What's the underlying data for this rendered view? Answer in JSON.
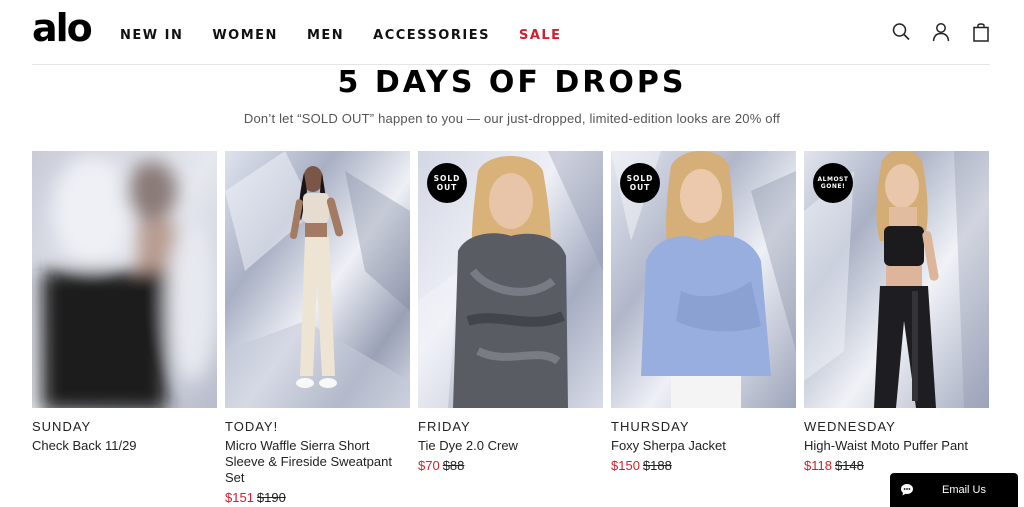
{
  "header": {
    "logo": "alo",
    "nav": [
      "NEW IN",
      "WOMEN",
      "MEN",
      "ACCESSORIES",
      "SALE"
    ],
    "icons": [
      "search-icon",
      "account-icon",
      "bag-icon"
    ]
  },
  "main": {
    "title": "5 DAYS OF DROPS",
    "subtitle": "Don’t let “SOLD OUT” happen to you — our just-dropped, limited-edition looks are 20% off"
  },
  "products": [
    {
      "day": "SUNDAY",
      "name": "Check Back 11/29",
      "sale_price": "",
      "orig_price": "",
      "badge": ""
    },
    {
      "day": "TODAY!",
      "name": "Micro Waffle Sierra Short Sleeve & Fireside Sweatpant Set",
      "sale_price": "$151",
      "orig_price": "$190",
      "badge": ""
    },
    {
      "day": "FRIDAY",
      "name": "Tie Dye 2.0 Crew",
      "sale_price": "$70",
      "orig_price": "$88",
      "badge": "SOLD OUT"
    },
    {
      "day": "THURSDAY",
      "name": "Foxy Sherpa Jacket",
      "sale_price": "$150",
      "orig_price": "$188",
      "badge": "SOLD OUT"
    },
    {
      "day": "WEDNESDAY",
      "name": "High-Waist Moto Puffer Pant",
      "sale_price": "$118",
      "orig_price": "$148",
      "badge": "ALMOST GONE!"
    }
  ],
  "email_widget": {
    "label": "Email Us"
  },
  "colors": {
    "sale": "#d21f2b",
    "text": "#111111",
    "badge": "#000000"
  }
}
